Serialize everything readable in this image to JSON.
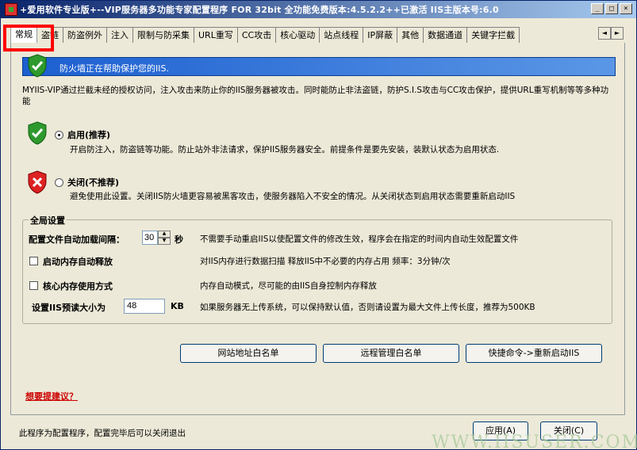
{
  "window": {
    "title": "+爱用软件专业版+--VIP服务器多功能专家配置程序 FOR 32bit 全功能免费版本:4.5.2.2++已激活 IIS主版本号:6.0",
    "btn_min": "_",
    "btn_max": "□",
    "btn_close": "×"
  },
  "tabs": [
    "常规",
    "盗链",
    "防盗例外",
    "注入",
    "限制与防采集",
    "URL重写",
    "CC攻击",
    "核心驱动",
    "站点线程",
    "IP屏蔽",
    "其他",
    "数据通道",
    "关键字拦截"
  ],
  "tab_scroll": {
    "left": "◄",
    "right": "►"
  },
  "banner": {
    "text": "防火墙正在帮助保护您的IIS."
  },
  "description": "MYIIS-VIP通过拦截未经的授权访问，注入攻击来防止你的IIS服务器被攻击。同时能防止非法盗链，防护S.I.S攻击与CC攻击保护，提供URL重写机制等等多种功能",
  "enable": {
    "label": "启用(推荐)",
    "desc": "开启防注入，防盗链等功能。防止站外非法请求，保护IIS服务器安全。前提条件是要先安装，装默认状态为启用状态."
  },
  "disable": {
    "label": "关闭(不推荐)",
    "desc": "避免使用此设置。关闭IIS防火墙更容易被黑客攻击，使服务器陷入不安全的情况。从关闭状态到启用状态需要重新启动IIS"
  },
  "global": {
    "title": "全局设置",
    "reload_label": "配置文件自动加载间隔：",
    "reload_value": "30",
    "reload_unit": "秒",
    "reload_desc": "不需要手动重启IIS以使配置文件的修改生效，程序会在指定的时间内自动生效配置文件",
    "mem_release_label": "启动内存自动释放",
    "mem_release_desc": "对IIS内存进行数据扫描 释放IIS中不必要的内存占用 频率：3分钟/次",
    "core_mem_label": "核心内存使用方式",
    "core_mem_desc": "内存自动模式，尽可能的由IIS自身控制内存释放",
    "preread_label": "设置IIS预读大小为",
    "preread_value": "48",
    "preread_unit": "KB",
    "preread_desc": "如果服务器无上传系统，可以保持默认值，否则请设置为最大文件上传长度，推荐为500KB"
  },
  "buttons": {
    "site_whitelist": "网站地址白名单",
    "remote_whitelist": "远程管理白名单",
    "restart_iis": "快捷命令->重新启动IIS",
    "apply": "应用(A)",
    "close": "关闭(C)"
  },
  "suggest_link": "想要提建议？",
  "status_text": "此程序为配置程序，配置完毕后可以关闭退出",
  "watermark": "WWW.IISUSER.COM"
}
